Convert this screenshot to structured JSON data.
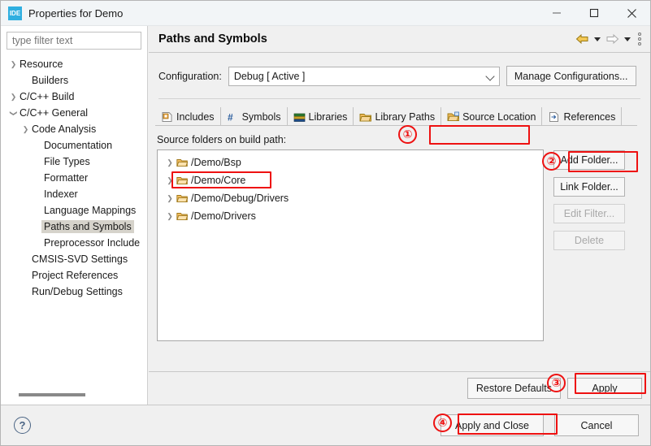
{
  "window": {
    "icon": "ide-icon",
    "title": "Properties for Demo",
    "minimize": "—",
    "maximize": "□",
    "close": "✕"
  },
  "sidebar": {
    "filter": {
      "value": "",
      "placeholder": "type filter text"
    },
    "items": [
      {
        "label": "Resource",
        "indent": 1,
        "twisty": "collapsed",
        "selected": false
      },
      {
        "label": "Builders",
        "indent": 2,
        "twisty": "none",
        "selected": false
      },
      {
        "label": "C/C++ Build",
        "indent": 1,
        "twisty": "collapsed",
        "selected": false
      },
      {
        "label": "C/C++ General",
        "indent": 1,
        "twisty": "expanded",
        "selected": false
      },
      {
        "label": "Code Analysis",
        "indent": 2,
        "twisty": "collapsed",
        "selected": false
      },
      {
        "label": "Documentation",
        "indent": 3,
        "twisty": "none",
        "selected": false
      },
      {
        "label": "File Types",
        "indent": 3,
        "twisty": "none",
        "selected": false
      },
      {
        "label": "Formatter",
        "indent": 3,
        "twisty": "none",
        "selected": false
      },
      {
        "label": "Indexer",
        "indent": 3,
        "twisty": "none",
        "selected": false
      },
      {
        "label": "Language Mappings",
        "indent": 3,
        "twisty": "none",
        "selected": false
      },
      {
        "label": "Paths and Symbols",
        "indent": 3,
        "twisty": "none",
        "selected": true
      },
      {
        "label": "Preprocessor Include",
        "indent": 3,
        "twisty": "none",
        "selected": false
      },
      {
        "label": "CMSIS-SVD Settings",
        "indent": 2,
        "twisty": "none",
        "selected": false
      },
      {
        "label": "Project References",
        "indent": 2,
        "twisty": "none",
        "selected": false
      },
      {
        "label": "Run/Debug Settings",
        "indent": 2,
        "twisty": "none",
        "selected": false
      }
    ]
  },
  "page": {
    "title": "Paths and Symbols",
    "nav": {
      "back_icon": "back-arrow-icon",
      "forward_icon": "forward-arrow-icon",
      "menu_icon": "view-menu-icon"
    }
  },
  "configuration": {
    "label": "Configuration:",
    "value": "Debug  [ Active ]",
    "manage_button": "Manage Configurations..."
  },
  "tabs": [
    {
      "label": "Includes",
      "icon": "includes-icon",
      "selected": false
    },
    {
      "label": "Symbols",
      "icon": "hash-icon",
      "selected": false
    },
    {
      "label": "Libraries",
      "icon": "libraries-icon",
      "selected": false
    },
    {
      "label": "Library Paths",
      "icon": "library-paths-icon",
      "selected": false
    },
    {
      "label": "Source Location",
      "icon": "source-location-icon",
      "selected": true
    },
    {
      "label": "References",
      "icon": "references-icon",
      "selected": false
    }
  ],
  "source": {
    "heading": "Source folders on build path:",
    "folders": [
      {
        "path": "/Demo/Bsp",
        "icon": "folder-icon",
        "highlighted": true
      },
      {
        "path": "/Demo/Core",
        "icon": "folder-icon",
        "highlighted": false
      },
      {
        "path": "/Demo/Debug/Drivers",
        "icon": "folder-icon",
        "highlighted": false
      },
      {
        "path": "/Demo/Drivers",
        "icon": "folder-icon",
        "highlighted": false
      }
    ],
    "buttons": [
      {
        "label": "Add Folder...",
        "enabled": true
      },
      {
        "label": "Link Folder...",
        "enabled": true
      },
      {
        "label": "Edit Filter...",
        "enabled": false
      },
      {
        "label": "Delete",
        "enabled": false
      }
    ]
  },
  "apply_bar": {
    "restore_defaults": "Restore Defaults",
    "apply": "Apply"
  },
  "footer": {
    "help_icon": "help-icon",
    "help_glyph": "?",
    "apply_and_close": "Apply and Close",
    "cancel": "Cancel"
  },
  "annotations": {
    "accent_color": "#ee1111",
    "markers": [
      {
        "number": "①",
        "target": "tab-source-location"
      },
      {
        "number": "②",
        "target": "add-folder-button"
      },
      {
        "number": "③",
        "target": "apply-button"
      },
      {
        "number": "④",
        "target": "apply-and-close-button"
      }
    ]
  }
}
